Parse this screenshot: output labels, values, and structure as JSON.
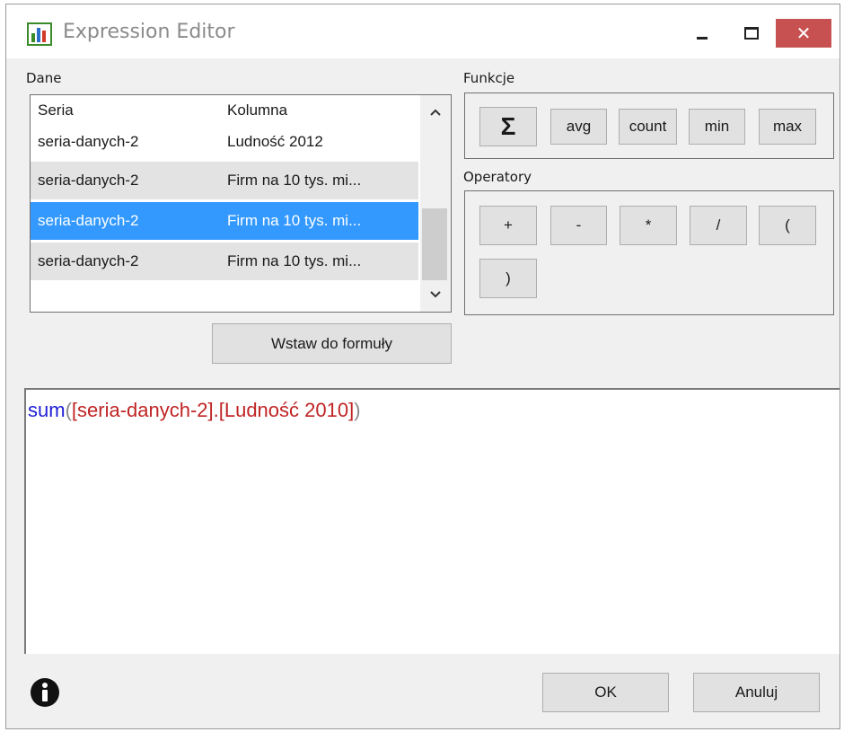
{
  "window": {
    "title": "Expression Editor"
  },
  "data_section": {
    "label": "Dane",
    "columns": [
      "Seria",
      "Kolumna"
    ],
    "rows": [
      {
        "series": "seria-danych-2",
        "column": "Ludność 2012"
      },
      {
        "series": "seria-danych-2",
        "column": "Firm na 10 tys. mi..."
      },
      {
        "series": "seria-danych-2",
        "column": "Firm na 10 tys. mi..."
      },
      {
        "series": "seria-danych-2",
        "column": "Firm na 10 tys. mi..."
      }
    ],
    "selected_row": 2,
    "insert_label": "Wstaw do formuły"
  },
  "functions": {
    "label": "Funkcje",
    "items": [
      "Σ",
      "avg",
      "count",
      "min",
      "max"
    ]
  },
  "operators": {
    "label": "Operatory",
    "items": [
      "+",
      "-",
      "*",
      "/",
      "(",
      ")"
    ]
  },
  "expression": {
    "fn": "sum",
    "open": "(",
    "ref": "[seria-danych-2].[Ludność 2010]",
    "close": ")"
  },
  "footer": {
    "ok_label": "OK",
    "cancel_label": "Anuluj"
  },
  "colors": {
    "selection": "#3399ff",
    "close": "#c75050",
    "function": "#1f1fd8",
    "reference": "#c02424"
  }
}
